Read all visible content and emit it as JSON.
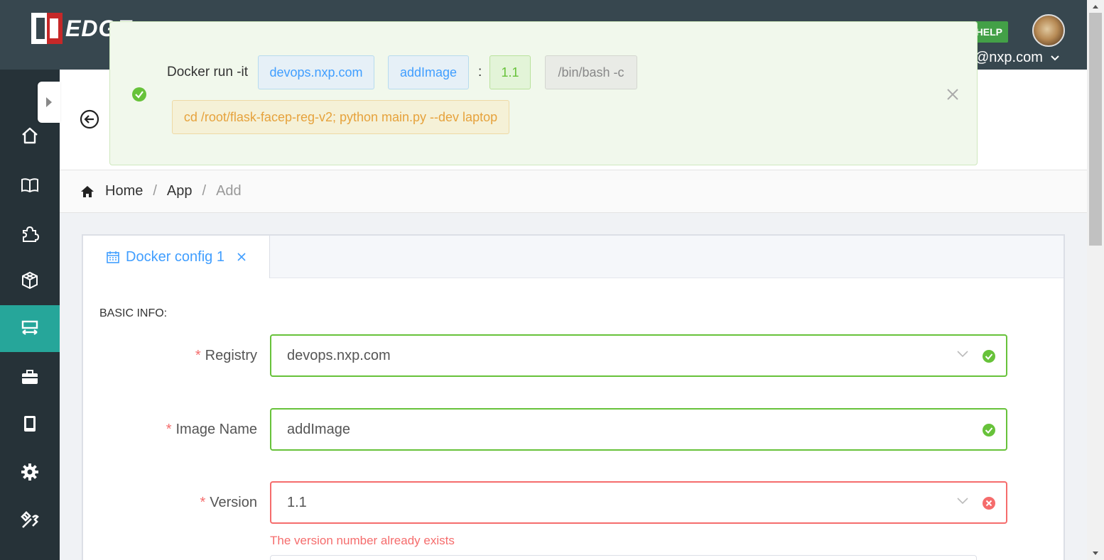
{
  "header": {
    "logo_text": "EDGE",
    "help_label": "HELP",
    "user_email": "@nxp.com"
  },
  "notification": {
    "prefix": "Docker run -it",
    "registry": "devops.nxp.com",
    "image": "addImage",
    "separator": ":",
    "version": "1.1",
    "shell": "/bin/bash -c",
    "command": "cd /root/flask-facep-reg-v2; python main.py --dev laptop"
  },
  "breadcrumb": {
    "home": "Home",
    "app": "App",
    "current": "Add",
    "separator": "/"
  },
  "tab": {
    "label": "Docker config 1"
  },
  "form": {
    "section_title": "BASIC INFO:",
    "required_mark": "*",
    "registry_label": "Registry",
    "registry_value": "devops.nxp.com",
    "image_label": "Image Name",
    "image_value": "addImage",
    "version_label": "Version",
    "version_value": "1.1",
    "version_error": "The version number already exists"
  },
  "sidebar": {
    "items": [
      "home-icon",
      "book-icon",
      "puzzle-icon",
      "cube-icon",
      "app-icon",
      "toolbox-icon",
      "device-icon",
      "settings-icon",
      "tools-icon"
    ],
    "active_index": 4
  },
  "colors": {
    "sidebar_bg": "#263238",
    "header_bg": "#37474f",
    "active": "#26a69a",
    "success": "#67c23a",
    "error": "#f56c6c",
    "primary": "#409eff"
  }
}
